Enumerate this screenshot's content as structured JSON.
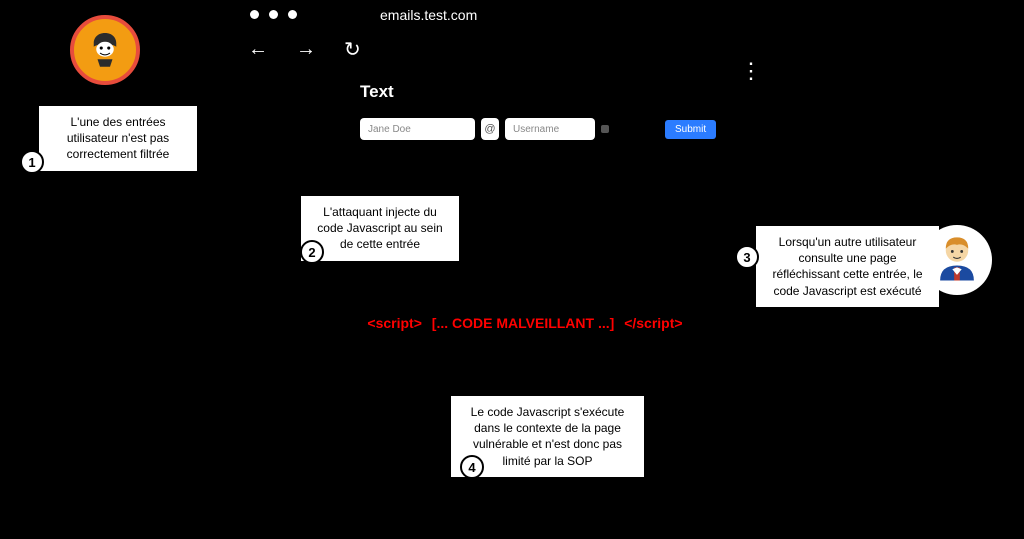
{
  "browser": {
    "url": "emails.test.com",
    "form_title": "Text",
    "name_placeholder": "Jane Doe",
    "at_symbol": "@",
    "username_placeholder": "Username",
    "submit_label": "Submit"
  },
  "callouts": {
    "c1": {
      "num": "1",
      "text": "L'une des entrées utilisateur n'est pas correctement filtrée"
    },
    "c2": {
      "num": "2",
      "text": "L'attaquant injecte du code Javascript au sein de cette entrée"
    },
    "c3": {
      "num": "3",
      "text": "Lorsqu'un autre utilisateur consulte une page réfléchissant cette entrée, le code Javascript est exécuté"
    },
    "c4": {
      "num": "4",
      "text": "Le code Javascript s'exécute dans le contexte de la page vulnérable et n'est donc pas limité par la SOP"
    }
  },
  "malicious_code": {
    "open_tag": "<script>",
    "body": "[... CODE MALVEILLANT ...]",
    "close_tag": "</script>"
  }
}
